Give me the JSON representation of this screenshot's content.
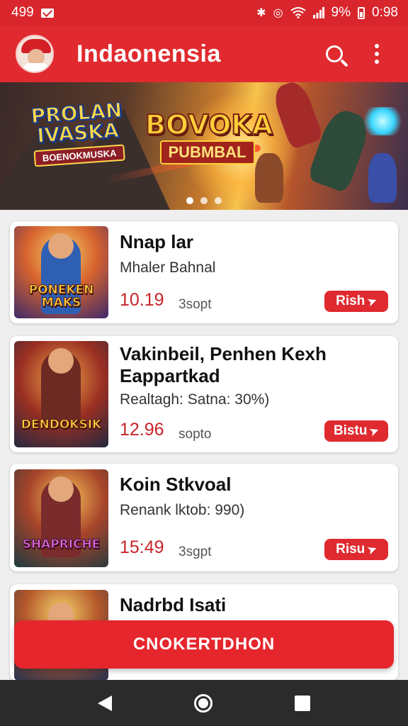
{
  "status_bar": {
    "time_left": "499",
    "battery": "9%",
    "time_right": "0:98",
    "icons": [
      "mail-icon",
      "bluetooth-icon",
      "vibrate-icon",
      "wifi-icon",
      "signal-icon",
      "battery-icon"
    ]
  },
  "app_bar": {
    "title": "Indaonensia",
    "icons": [
      "search-icon",
      "more-vert-icon"
    ]
  },
  "banner": {
    "logo_left_line1": "PROLAN",
    "logo_left_line2": "IVASKA",
    "logo_left_tag": "BOENOKMUSKA",
    "logo_right_line1": "BOVOKA",
    "logo_right_tag": "PUBMBAL",
    "pages": 3,
    "active_page": 0
  },
  "items": [
    {
      "thumb_label_1": "PONEKEN",
      "thumb_label_2": "MAKS",
      "title": "Nnap lar",
      "subtitle": "Mhaler Bahnal",
      "price": "10.19",
      "unit": "3sopt",
      "button": "Rish"
    },
    {
      "thumb_label_1": "DENDOKSIK",
      "thumb_label_2": "",
      "title": "Vakinbeil, Penhen Kexh Eappartkad",
      "subtitle": "Realtagh: Satna: 30%)",
      "price": "12.96",
      "unit": "sopto",
      "button": "Bistu"
    },
    {
      "thumb_label_1": "SHAPRICHE",
      "thumb_label_2": "",
      "title": "Koin Stkvoal",
      "subtitle": "Renank lktob: 990)",
      "price": "15:49",
      "unit": "3sgpt",
      "button": "Risu"
    },
    {
      "thumb_label_1": "",
      "thumb_label_2": "",
      "title": "Nadrbd Isati",
      "subtitle": "",
      "price": "",
      "unit": "",
      "button": ""
    }
  ],
  "primary_button": "CNOKERTDHON",
  "colors": {
    "brand_red": "#e02a2f",
    "status_red": "#d8262c",
    "price_red": "#c8242b",
    "nav_dark": "#2b2b2b"
  },
  "nav_bar": {
    "icons": [
      "back-icon",
      "home-icon",
      "recents-icon"
    ]
  }
}
